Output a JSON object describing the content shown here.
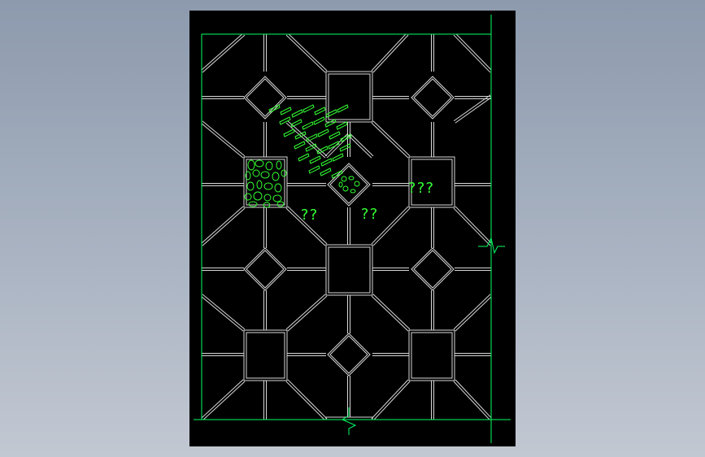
{
  "colors": {
    "background": "#000000",
    "tile_line": "#d8d8d8",
    "border": "#00ff66",
    "hatch": "#33ff33",
    "label": "#33ff33"
  },
  "labels": {
    "pattern_gravel": "???",
    "pattern_left": "??",
    "pattern_right": "??"
  }
}
